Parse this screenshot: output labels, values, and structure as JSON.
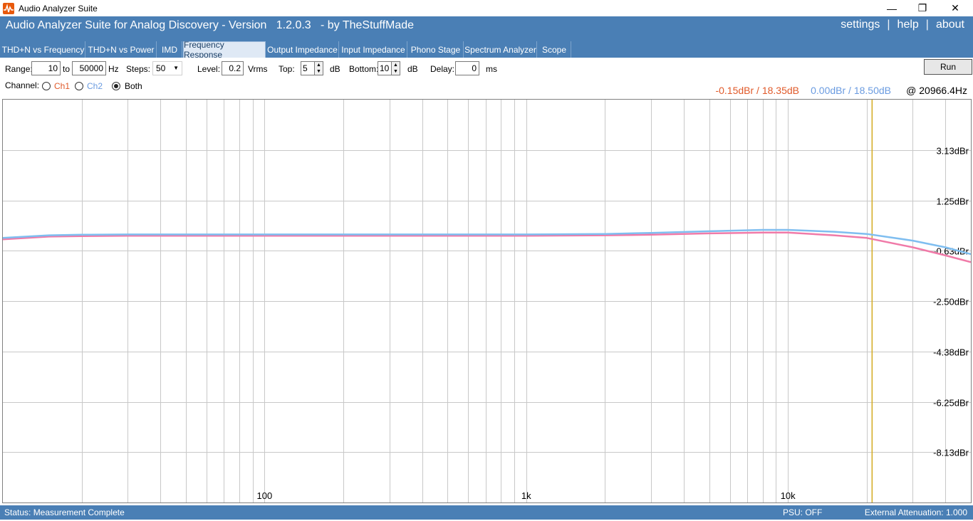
{
  "window": {
    "title": "Audio Analyzer Suite",
    "controls": {
      "minimize": "—",
      "maximize": "❐",
      "close": "✕"
    }
  },
  "header": {
    "title": "Audio Analyzer Suite for Analog Discovery - Version   1.2.0.3   - by TheStuffMade",
    "links": {
      "settings": "settings",
      "sep1": "|",
      "help": "help",
      "sep2": "|",
      "about": "about"
    }
  },
  "tabs": [
    {
      "label": "THD+N vs Frequency"
    },
    {
      "label": "THD+N vs Power"
    },
    {
      "label": "IMD"
    },
    {
      "label": "Frequency Response"
    },
    {
      "label": "Output Impedance"
    },
    {
      "label": "Input Impedance"
    },
    {
      "label": "Phono Stage"
    },
    {
      "label": "Spectrum Analyzer"
    },
    {
      "label": "Scope"
    }
  ],
  "active_tab": "Frequency Response",
  "controls": {
    "range_label": "Range:",
    "range_from": "10",
    "to_label": "to",
    "range_to": "50000",
    "hz_label": "Hz",
    "steps_label": "Steps:",
    "steps_value": "50",
    "level_label": "Level:",
    "level_value": "0.2",
    "vrms_label": "Vrms",
    "top_label": "Top:",
    "top_value": "5",
    "db_label1": "dB",
    "bottom_label": "Bottom:",
    "bottom_value": "10",
    "db_label2": "dB",
    "delay_label": "Delay:",
    "delay_value": "0",
    "ms_label": "ms",
    "run_label": "Run",
    "channel_label": "Channel:",
    "ch1_label": "Ch1",
    "ch2_label": "Ch2",
    "both_label": "Both",
    "selected_channel": "Both"
  },
  "readouts": {
    "ch1": "-0.15dBr / 18.35dB",
    "ch2": "0.00dBr / 18.50dB",
    "freq": "@ 20966.4Hz"
  },
  "colors": {
    "accent": "#4a7fb5",
    "ch1": "#f07aa8",
    "ch2": "#7fbef0",
    "ch1_text": "#e05a2a",
    "ch2_text": "#6a9be0",
    "cursor": "#d4aa20",
    "grid": "#c8c8c8"
  },
  "chart_data": {
    "type": "line",
    "x_scale": "log",
    "xlim": [
      10,
      50000
    ],
    "ylim": [
      -10,
      5
    ],
    "x_tick_labels": [
      "100",
      "1k",
      "10k"
    ],
    "x_tick_values": [
      100,
      1000,
      10000
    ],
    "y_tick_labels": [
      "3.13dBr",
      "1.25dBr",
      "-0.63dBr",
      "-2.50dBr",
      "-4.38dBr",
      "-6.25dBr",
      "-8.13dBr"
    ],
    "y_tick_values": [
      3.125,
      1.25,
      -0.625,
      -2.5,
      -4.375,
      -6.25,
      -8.125
    ],
    "grid": true,
    "cursor_x": 20966.4,
    "series": [
      {
        "name": "Ch1",
        "x": [
          10,
          15,
          20,
          30,
          50,
          100,
          200,
          500,
          1000,
          2000,
          3000,
          5000,
          8000,
          10000,
          15000,
          20000,
          30000,
          40000,
          50000
        ],
        "y": [
          -0.2,
          -0.1,
          -0.08,
          -0.07,
          -0.07,
          -0.07,
          -0.07,
          -0.07,
          -0.07,
          -0.05,
          -0.03,
          0.02,
          0.05,
          0.05,
          -0.05,
          -0.15,
          -0.5,
          -0.8,
          -1.05
        ]
      },
      {
        "name": "Ch2",
        "x": [
          10,
          15,
          20,
          30,
          50,
          100,
          200,
          500,
          1000,
          2000,
          3000,
          5000,
          8000,
          10000,
          15000,
          20000,
          30000,
          40000,
          50000
        ],
        "y": [
          -0.15,
          -0.05,
          -0.03,
          -0.02,
          -0.02,
          -0.02,
          -0.02,
          -0.02,
          -0.02,
          0.0,
          0.04,
          0.1,
          0.15,
          0.15,
          0.08,
          0.0,
          -0.25,
          -0.5,
          -0.75
        ]
      }
    ]
  },
  "status": {
    "message": "Status: Measurement Complete",
    "psu": "PSU: OFF",
    "attenuation": "External Attenuation: 1.000"
  }
}
